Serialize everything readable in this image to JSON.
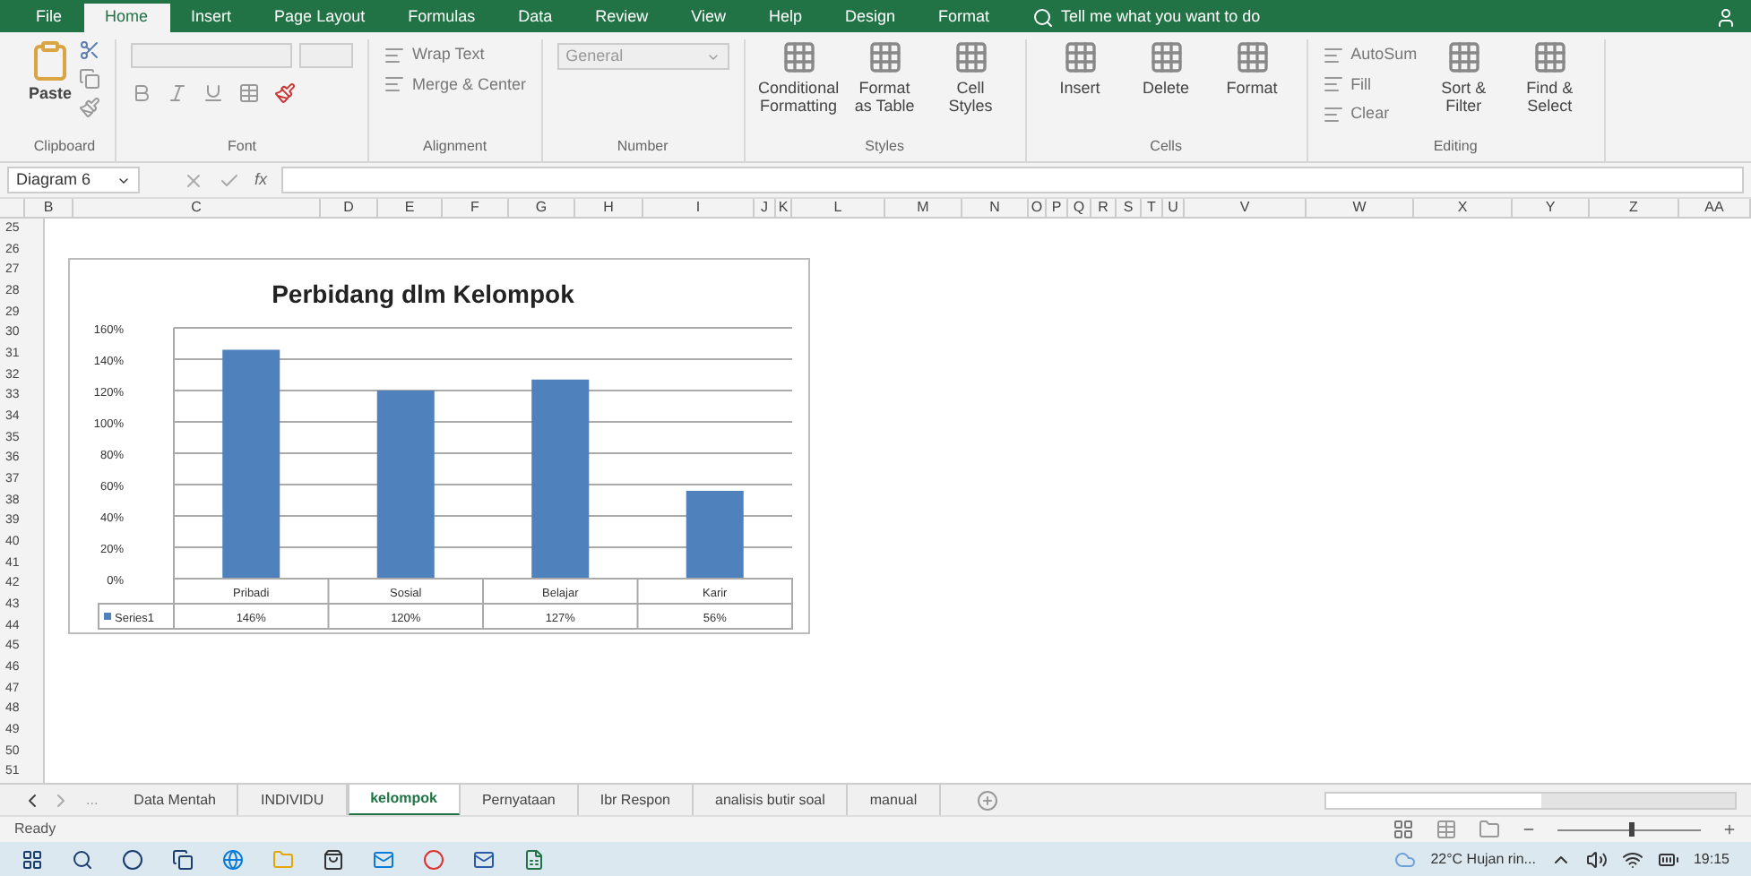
{
  "ribbon_tabs": [
    {
      "label": "File",
      "selected": false
    },
    {
      "label": "Home",
      "selected": true
    },
    {
      "label": "Insert",
      "selected": false
    },
    {
      "label": "Page Layout",
      "selected": false
    },
    {
      "label": "Formulas",
      "selected": false
    },
    {
      "label": "Data",
      "selected": false
    },
    {
      "label": "Review",
      "selected": false
    },
    {
      "label": "View",
      "selected": false
    },
    {
      "label": "Help",
      "selected": false
    },
    {
      "label": "Design",
      "selected": false
    },
    {
      "label": "Format",
      "selected": false
    }
  ],
  "tell_me": "Tell me what you want to do",
  "ribbon_groups": [
    {
      "name": "Clipboard",
      "kind": "clipboard",
      "items": [
        {
          "label": "Paste"
        }
      ]
    },
    {
      "name": "Font",
      "kind": "font"
    },
    {
      "name": "Alignment",
      "kind": "alignment",
      "items": [
        {
          "label": "Wrap Text",
          "kind": "small"
        },
        {
          "label": "Merge & Center",
          "kind": "small"
        }
      ]
    },
    {
      "name": "Number",
      "kind": "number",
      "items": [
        {
          "label": "General",
          "kind": "dropdown"
        }
      ]
    },
    {
      "name": "Styles",
      "kind": "styles",
      "items": [
        {
          "label": "Conditional Formatting",
          "kind": "large"
        },
        {
          "label": "Format as Table",
          "kind": "large"
        },
        {
          "label": "Cell Styles",
          "kind": "large"
        }
      ]
    },
    {
      "name": "Cells",
      "kind": "cells",
      "items": [
        {
          "label": "Insert",
          "kind": "large"
        },
        {
          "label": "Delete",
          "kind": "large"
        },
        {
          "label": "Format",
          "kind": "large"
        }
      ]
    },
    {
      "name": "Editing",
      "kind": "editing",
      "items": [
        {
          "label": "AutoSum",
          "kind": "small"
        },
        {
          "label": "Fill",
          "kind": "small"
        },
        {
          "label": "Clear",
          "kind": "small"
        },
        {
          "label": "Sort & Filter",
          "kind": "large"
        },
        {
          "label": "Find & Select",
          "kind": "large"
        }
      ]
    }
  ],
  "formula_bar": {
    "name_box": "Diagram 6",
    "fx": "fx"
  },
  "columns": [
    "B",
    "C",
    "D",
    "E",
    "F",
    "G",
    "H",
    "I",
    "J",
    "K",
    "L",
    "M",
    "N",
    "O",
    "P",
    "Q",
    "R",
    "S",
    "T",
    "U",
    "V",
    "W",
    "X",
    "Y",
    "Z",
    "AA"
  ],
  "rows": [
    "25",
    "26",
    "27",
    "28",
    "29",
    "30",
    "31",
    "32",
    "33",
    "34",
    "35",
    "36",
    "37",
    "38",
    "39",
    "40",
    "41",
    "42",
    "43",
    "44",
    "45",
    "46",
    "47",
    "48",
    "49",
    "50",
    "51"
  ],
  "chart": {
    "chart_data": {
      "type": "bar",
      "title": "Perbidang  dlm Kelompok",
      "categories": [
        "Pribadi",
        "Sosial",
        "Belajar",
        "Karir"
      ],
      "series": [
        {
          "name": "Series1",
          "color": "#4f81bd",
          "values": [
            1.46,
            1.2,
            1.27,
            0.56
          ]
        }
      ],
      "ylim": [
        0,
        1.6
      ],
      "grid": true,
      "yticks": [
        {
          "value": 0,
          "label": "0%"
        },
        {
          "value": 0.2,
          "label": "20%"
        },
        {
          "value": 0.4,
          "label": "40%"
        },
        {
          "value": 0.6,
          "label": "60%"
        },
        {
          "value": 0.8,
          "label": "80%"
        },
        {
          "value": 1,
          "label": "100%"
        },
        {
          "value": 1.2,
          "label": "120%"
        },
        {
          "value": 1.4,
          "label": "140%"
        },
        {
          "value": 1.6,
          "label": "160%"
        }
      ],
      "value_labels": [
        "146%",
        "120%",
        "127%",
        "56%"
      ]
    }
  },
  "sheet_tabs": [
    {
      "label": "Data Mentah",
      "selected": false
    },
    {
      "label": "INDIVIDU",
      "selected": false
    },
    {
      "label": "kelompok",
      "selected": true
    },
    {
      "label": "Pernyataan",
      "selected": false
    },
    {
      "label": "Ibr Respon",
      "selected": false
    },
    {
      "label": "analisis butir soal",
      "selected": false
    },
    {
      "label": "manual",
      "selected": false
    }
  ],
  "sheet_more": "...",
  "status": {
    "text": "Ready",
    "zoom": {
      "level": 0.5
    }
  },
  "taskbar": {
    "weather": "22°C Hujan rin...",
    "time": "19:15"
  }
}
